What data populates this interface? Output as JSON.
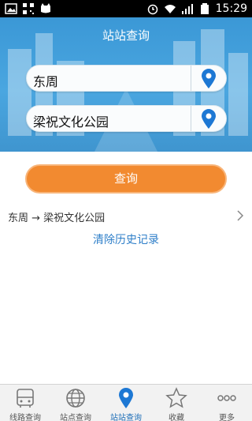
{
  "status_bar": {
    "time": "15:29"
  },
  "header": {
    "title": "站站查询"
  },
  "search": {
    "from_value": "东周",
    "to_value": "梁祝文化公园"
  },
  "query_button": {
    "label": "查询"
  },
  "history": {
    "items": [
      {
        "label": "东周 → 梁祝文化公园"
      }
    ],
    "clear_label": "清除历史记录"
  },
  "bottom_nav": {
    "items": [
      {
        "label": "线路查询",
        "icon": "bus-icon"
      },
      {
        "label": "站点查询",
        "icon": "globe-icon"
      },
      {
        "label": "站站查询",
        "icon": "location-pin-icon",
        "active": true
      },
      {
        "label": "收藏",
        "icon": "star-icon"
      },
      {
        "label": "更多",
        "icon": "more-icon"
      }
    ]
  },
  "colors": {
    "primary_blue": "#3b98d6",
    "button_orange": "#f28a30",
    "link_blue": "#2f7fc9",
    "nav_active": "#1f6fb8"
  }
}
